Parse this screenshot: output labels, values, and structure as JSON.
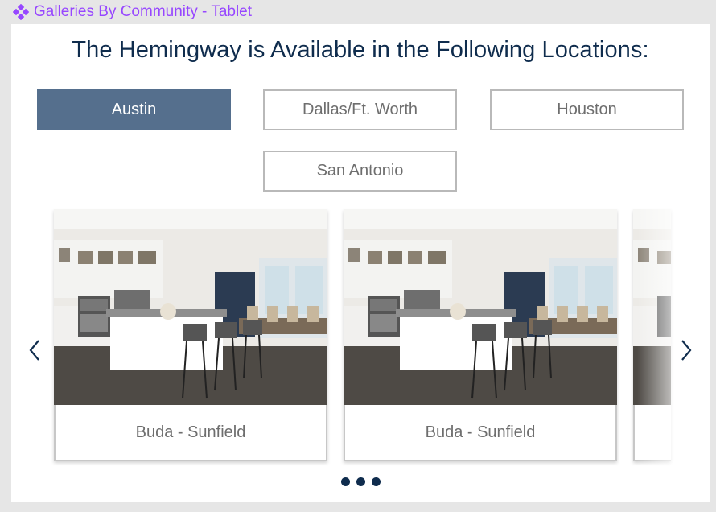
{
  "frame": {
    "label": "Galleries By Community - Tablet",
    "icon": "component-diamond-icon",
    "color": "#9747ff"
  },
  "heading": "The Hemingway is Available in the Following Locations:",
  "locations": [
    {
      "label": "Austin",
      "active": true
    },
    {
      "label": "Dallas/Ft. Worth",
      "active": false
    },
    {
      "label": "Houston",
      "active": false
    },
    {
      "label": "San Antonio",
      "active": false
    }
  ],
  "carousel": {
    "prev_icon": "chevron-left-icon",
    "next_icon": "chevron-right-icon",
    "cards": [
      {
        "caption": "Buda - Sunfield",
        "image": "kitchen-photo"
      },
      {
        "caption": "Buda - Sunfield",
        "image": "kitchen-photo"
      },
      {
        "caption": "",
        "image": "kitchen-photo"
      }
    ],
    "dots": 3
  },
  "colors": {
    "accent": "#556f8d",
    "heading": "#0f2c4d",
    "dot": "#0f2c4d"
  }
}
